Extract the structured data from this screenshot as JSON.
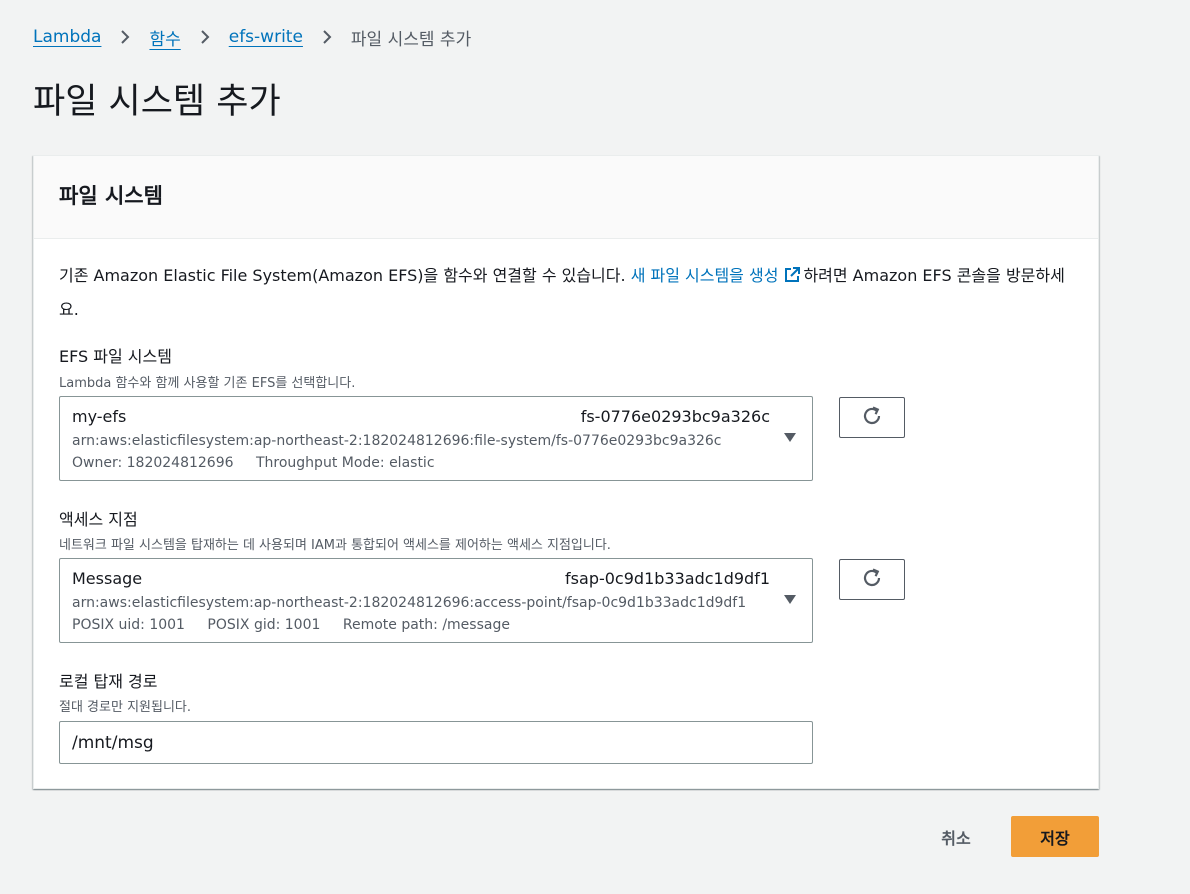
{
  "breadcrumb": {
    "items": [
      {
        "label": "Lambda"
      },
      {
        "label": "함수"
      },
      {
        "label": "efs-write"
      }
    ],
    "current": "파일 시스템 추가"
  },
  "page": {
    "title": "파일 시스템 추가"
  },
  "card": {
    "title": "파일 시스템",
    "description": {
      "before_link": "기존 Amazon Elastic File System(Amazon EFS)을 함수와 연결할 수 있습니다. ",
      "link_text": "새 파일 시스템을 생성",
      "after_link": "하려면 Amazon EFS 콘솔을 방문하세요."
    }
  },
  "efs_field": {
    "label": "EFS 파일 시스템",
    "hint": "Lambda 함수와 함께 사용할 기존 EFS를 선택합니다.",
    "selected": {
      "name": "my-efs",
      "id": "fs-0776e0293bc9a326c",
      "arn": "arn:aws:elasticfilesystem:ap-northeast-2:182024812696:file-system/fs-0776e0293bc9a326c",
      "owner": "Owner: 182024812696",
      "throughput": "Throughput Mode: elastic"
    }
  },
  "access_point_field": {
    "label": "액세스 지점",
    "hint": "네트워크 파일 시스템을 탑재하는 데 사용되며 IAM과 통합되어 액세스를 제어하는 액세스 지점입니다.",
    "selected": {
      "name": "Message",
      "id": "fsap-0c9d1b33adc1d9df1",
      "arn": "arn:aws:elasticfilesystem:ap-northeast-2:182024812696:access-point/fsap-0c9d1b33adc1d9df1",
      "uid": "POSIX uid: 1001",
      "gid": "POSIX gid: 1001",
      "remote_path": "Remote path: /message"
    }
  },
  "mount_path_field": {
    "label": "로컬 탑재 경로",
    "hint": "절대 경로만 지원됩니다.",
    "value": "/mnt/msg"
  },
  "footer": {
    "cancel_label": "취소",
    "save_label": "저장"
  },
  "colors": {
    "link": "#0073bb",
    "primary_button": "#f29e38",
    "background": "#f2f3f3"
  },
  "icons": {
    "breadcrumb_separator": "chevron-right-icon",
    "external_link": "external-link-icon",
    "refresh": "refresh-icon",
    "dropdown": "caret-down-icon"
  }
}
